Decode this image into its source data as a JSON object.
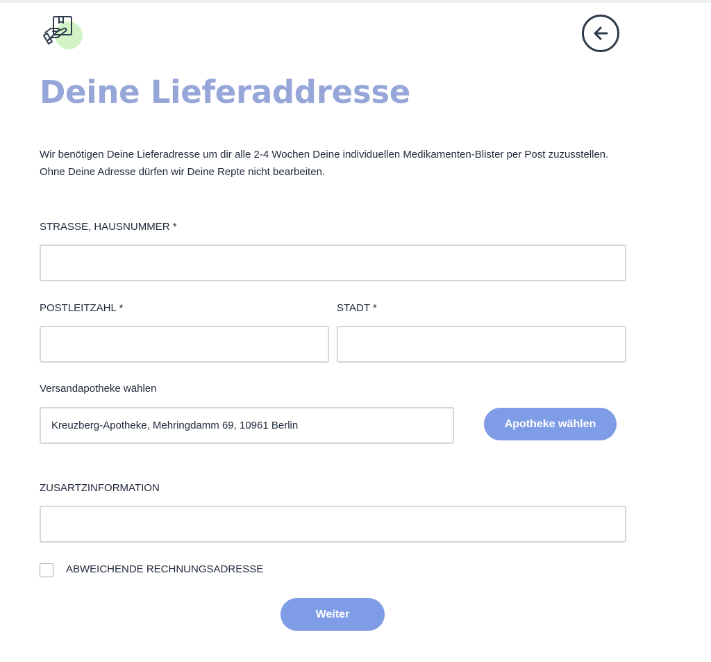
{
  "header": {
    "logo_icon": "box-in-hand-icon",
    "back_icon": "arrow-left-circle-icon"
  },
  "page": {
    "title": "Deine Lieferaddresse",
    "intro": "Wir benötigen Deine Lieferadresse um dir alle 2-4 Wochen Deine individuellen Medikamenten-Blister per Post zuzusstellen. Ohne Deine Adresse dürfen wir Deine Repte nicht bearbeiten."
  },
  "form": {
    "street": {
      "label": "STRASSE, HAUSNUMMER *",
      "value": ""
    },
    "zip": {
      "label": "POSTLEITZAHL *",
      "value": ""
    },
    "city": {
      "label": "STADT *",
      "value": ""
    },
    "pharmacy": {
      "label": "Versandapotheke wählen",
      "value": "Kreuzberg-Apotheke, Mehringdamm 69, 10961 Berlin"
    },
    "choose_pharmacy_button": "Apotheke wählen",
    "extra": {
      "label": "ZUSARTZINFORMATION",
      "value": ""
    },
    "billing_checkbox": {
      "label": "ABWEICHENDE RECHNUNGSADRESSE",
      "checked": false
    },
    "submit_button": "Weiter"
  },
  "colors": {
    "accent": "#7f9ce6",
    "title": "#97a6d8",
    "logo_circle": "#d2f3c6",
    "text": "#1f2a3a",
    "border": "#d6d6d6"
  }
}
